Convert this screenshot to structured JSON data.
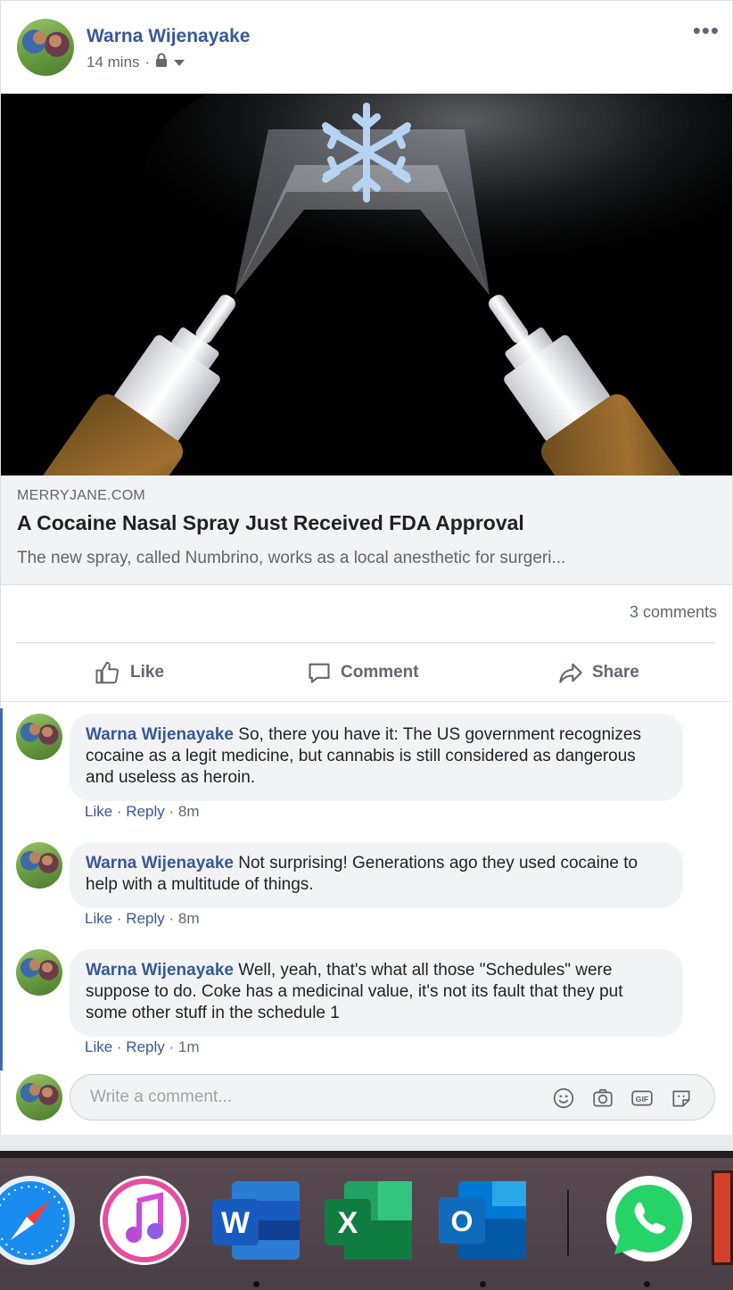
{
  "post": {
    "author": "Warna Wijenayake",
    "time": "14 mins",
    "more_icon": "more-options-icon",
    "privacy_icon": "lock-icon",
    "audience_icon": "caret-down-icon"
  },
  "link": {
    "domain": "MERRYJANE.COM",
    "title": "A Cocaine Nasal Spray Just Received FDA Approval",
    "description": "The new spray, called Numbrino, works as a local anesthetic for surgeri..."
  },
  "stats": {
    "comments": "3 comments"
  },
  "actions": {
    "like": "Like",
    "comment": "Comment",
    "share": "Share"
  },
  "comments": [
    {
      "author": "Warna Wijenayake",
      "text": "So, there you have it: The US government recognizes cocaine as a legit medicine, but cannabis is still considered as dangerous and useless as heroin.",
      "like": "Like",
      "reply": "Reply",
      "time": "8m"
    },
    {
      "author": "Warna Wijenayake",
      "text": "Not surprising! Generations ago they used cocaine to help with a multitude of things.",
      "like": "Like",
      "reply": "Reply",
      "time": "8m"
    },
    {
      "author": "Warna Wijenayake",
      "text": "Well, yeah, that's what all those \"Schedules\" were suppose to do. Coke has a medicinal value, it's not its fault that they put some other stuff in the schedule 1",
      "like": "Like",
      "reply": "Reply",
      "time": "1m"
    }
  ],
  "composer": {
    "placeholder": "Write a comment..."
  },
  "dock": {
    "apps": [
      "safari-icon",
      "itunes-icon",
      "word-icon",
      "excel-icon",
      "outlook-icon",
      "whatsapp-icon"
    ],
    "word_letter": "W",
    "excel_letter": "X",
    "outlook_letter": "O"
  },
  "colors": {
    "link_blue": "#385898",
    "fb_blue": "#4267b2",
    "secondary_text": "#606770"
  }
}
